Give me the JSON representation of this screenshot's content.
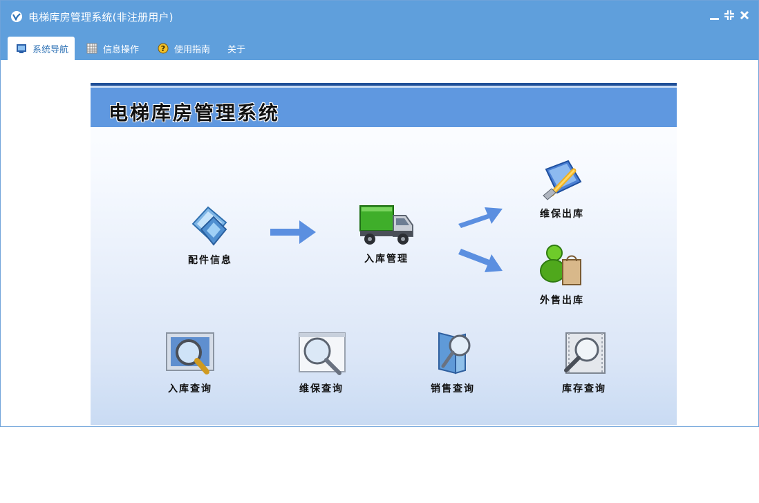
{
  "window": {
    "title": "电梯库房管理系统(非注册用户)"
  },
  "menu": {
    "items": [
      {
        "label": "系统导航",
        "icon": "monitor-icon",
        "active": true
      },
      {
        "label": "信息操作",
        "icon": "grid-icon",
        "active": false
      },
      {
        "label": "使用指南",
        "icon": "help-icon",
        "active": false
      },
      {
        "label": "关于",
        "icon": "",
        "active": false
      }
    ]
  },
  "panel": {
    "title": "电梯库房管理系统"
  },
  "flow": {
    "parts_info": {
      "label": "配件信息",
      "icon": "parts-info-icon"
    },
    "stock_in": {
      "label": "入库管理",
      "icon": "truck-icon"
    },
    "maintenance_out": {
      "label": "维保出库",
      "icon": "wrench-icon"
    },
    "sales_out": {
      "label": "外售出库",
      "icon": "customer-bag-icon"
    }
  },
  "queries": [
    {
      "label": "入库查询",
      "icon": "stockin-search-icon"
    },
    {
      "label": "维保查询",
      "icon": "maintenance-search-icon"
    },
    {
      "label": "销售查询",
      "icon": "sales-search-icon"
    },
    {
      "label": "库存查询",
      "icon": "inventory-search-icon"
    }
  ],
  "colors": {
    "titlebar": "#5f9fdc",
    "header_band": "#5f98e0",
    "arrow": "#5b8fe0"
  }
}
